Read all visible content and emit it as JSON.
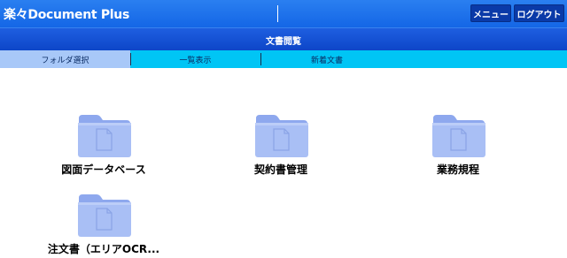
{
  "header": {
    "app_title": "楽々Document Plus",
    "menu_label": "メニュー",
    "logout_label": "ログアウト"
  },
  "section": {
    "title": "文書閲覧"
  },
  "tabs": [
    {
      "label": "フォルダ選択",
      "active": true
    },
    {
      "label": "一覧表示",
      "active": false
    },
    {
      "label": "新着文書",
      "active": false
    }
  ],
  "folders": [
    {
      "label": "図面データベース"
    },
    {
      "label": "契約書管理"
    },
    {
      "label": "業務規程"
    },
    {
      "label": "注文書（エリアOCR..."
    }
  ],
  "colors": {
    "header": "#1466e6",
    "section_bar": "#0d46c8",
    "tab_bar": "#00c5f5",
    "active_tab": "#a8c8f8",
    "folder": "#a9bff5"
  }
}
